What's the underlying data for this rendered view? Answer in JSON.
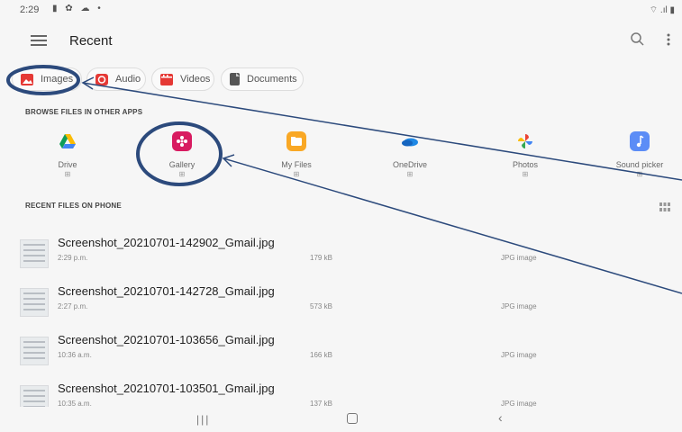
{
  "status": {
    "time": "2:29",
    "left_icons": "▮ ✿ ☁ •",
    "right_icons": "⌔ .ıl ▮"
  },
  "header": {
    "title": "Recent"
  },
  "chips": [
    {
      "label": "Images",
      "icon": "image-icon",
      "color": "#e53935"
    },
    {
      "label": "Audio",
      "icon": "audio-icon",
      "color": "#e53935"
    },
    {
      "label": "Videos",
      "icon": "video-icon",
      "color": "#e53935"
    },
    {
      "label": "Documents",
      "icon": "document-icon",
      "color": "#555555"
    }
  ],
  "apps_section_label": "BROWSE FILES IN OTHER APPS",
  "apps": [
    {
      "label": "Drive",
      "sub": "⊞",
      "icon": "drive-icon"
    },
    {
      "label": "Gallery",
      "sub": "⊞",
      "icon": "gallery-icon",
      "color": "#d81b60"
    },
    {
      "label": "My Files",
      "sub": "⊞",
      "icon": "my-files-icon",
      "color": "#f9a825"
    },
    {
      "label": "OneDrive",
      "sub": "⊞",
      "icon": "onedrive-icon",
      "color": "#1e88e5"
    },
    {
      "label": "Photos",
      "sub": "⊞",
      "icon": "photos-icon"
    },
    {
      "label": "Sound picker",
      "sub": "⊞",
      "icon": "sound-picker-icon",
      "color": "#5c8df6"
    }
  ],
  "files_section_label": "RECENT FILES ON PHONE",
  "files": [
    {
      "name": "Screenshot_20210701-142902_Gmail.jpg",
      "time": "2:29 p.m.",
      "size": "179 kB",
      "type": "JPG image"
    },
    {
      "name": "Screenshot_20210701-142728_Gmail.jpg",
      "time": "2:27 p.m.",
      "size": "573 kB",
      "type": "JPG image"
    },
    {
      "name": "Screenshot_20210701-103656_Gmail.jpg",
      "time": "10:36 a.m.",
      "size": "166 kB",
      "type": "JPG image"
    },
    {
      "name": "Screenshot_20210701-103501_Gmail.jpg",
      "time": "10:35 a.m.",
      "size": "137 kB",
      "type": "JPG image"
    }
  ],
  "nav": {
    "recent": "|||",
    "back": "‹"
  },
  "annotation_color": "#2c4a7c"
}
